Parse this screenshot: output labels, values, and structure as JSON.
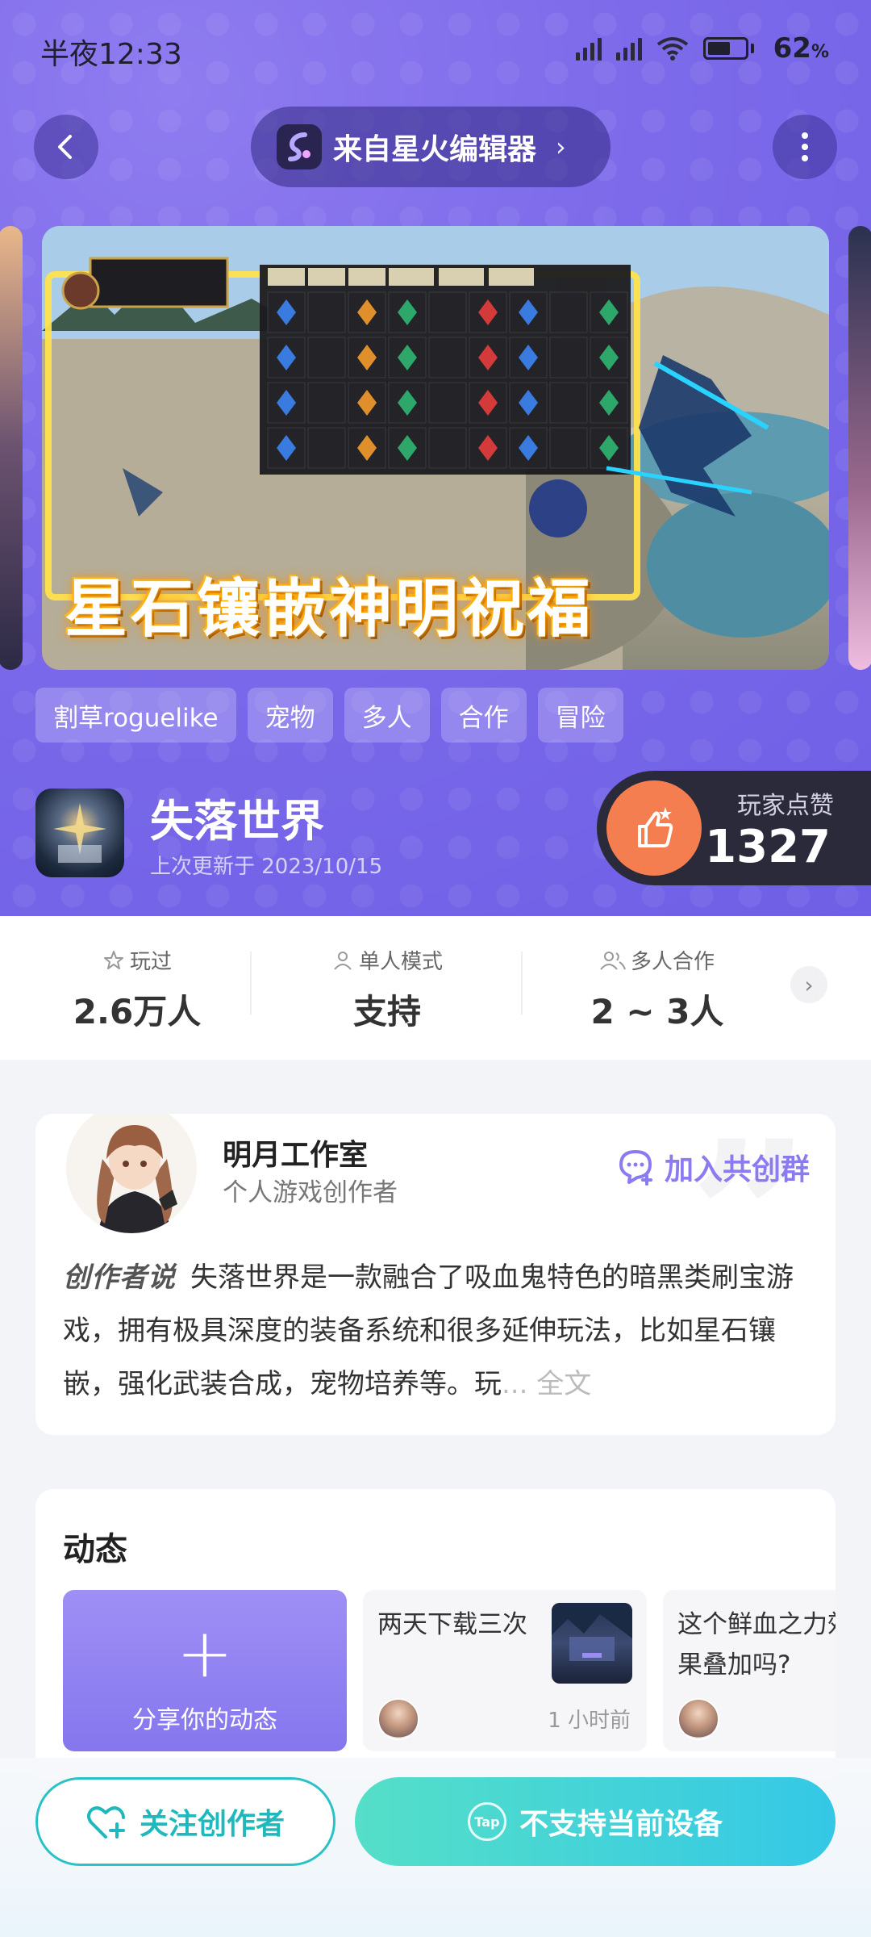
{
  "status_bar": {
    "time": "半夜12:33",
    "battery_percent": "62",
    "battery_unit": "%",
    "battery_level": 0.62
  },
  "header": {
    "source_label": "来自星火编辑器",
    "chevron": "›"
  },
  "banner": {
    "title": "星石镶嵌神明祝福",
    "inventory_tabs": [
      "装备栏",
      "星石",
      "宠物",
      "物品栏",
      "行囊一",
      "行囊二"
    ]
  },
  "tags": [
    "割草roguelike",
    "宠物",
    "多人",
    "合作",
    "冒险"
  ],
  "game": {
    "name": "失落世界",
    "updated": "上次更新于 2023/10/15"
  },
  "likes": {
    "label": "玩家点赞",
    "count": "1327"
  },
  "stats": [
    {
      "icon": "star-outline-icon",
      "label": "玩过",
      "value": "2.6万人"
    },
    {
      "icon": "person-icon",
      "label": "单人模式",
      "value": "支持"
    },
    {
      "icon": "people-icon",
      "label": "多人合作",
      "value": "2 ~ 3人"
    }
  ],
  "creator": {
    "name": "明月工作室",
    "role": "个人游戏创作者",
    "join_label": "加入共创群",
    "desc_label": "创作者说",
    "description": "失落世界是一款融合了吸血鬼特色的暗黑类刷宝游戏，拥有极具深度的装备系统和很多延伸玩法，比如星石镶嵌，强化武装合成，宠物培养等。玩",
    "more_label": "... 全文"
  },
  "dynamics": {
    "title": "动态",
    "share_label": "分享你的动态",
    "posts": [
      {
        "text": "两天下载三次",
        "time": "1 小时前"
      },
      {
        "text": "这个鲜血之力效果叠加吗?"
      }
    ]
  },
  "bottom": {
    "follow_label": "关注创作者",
    "device_label": "不支持当前设备",
    "tap_logo": "Tap"
  },
  "colors": {
    "hero": "#7d6bea",
    "accent": "#8a7bf0",
    "teal": "#2ac2c6",
    "likes_orange": "#f47e4f"
  }
}
